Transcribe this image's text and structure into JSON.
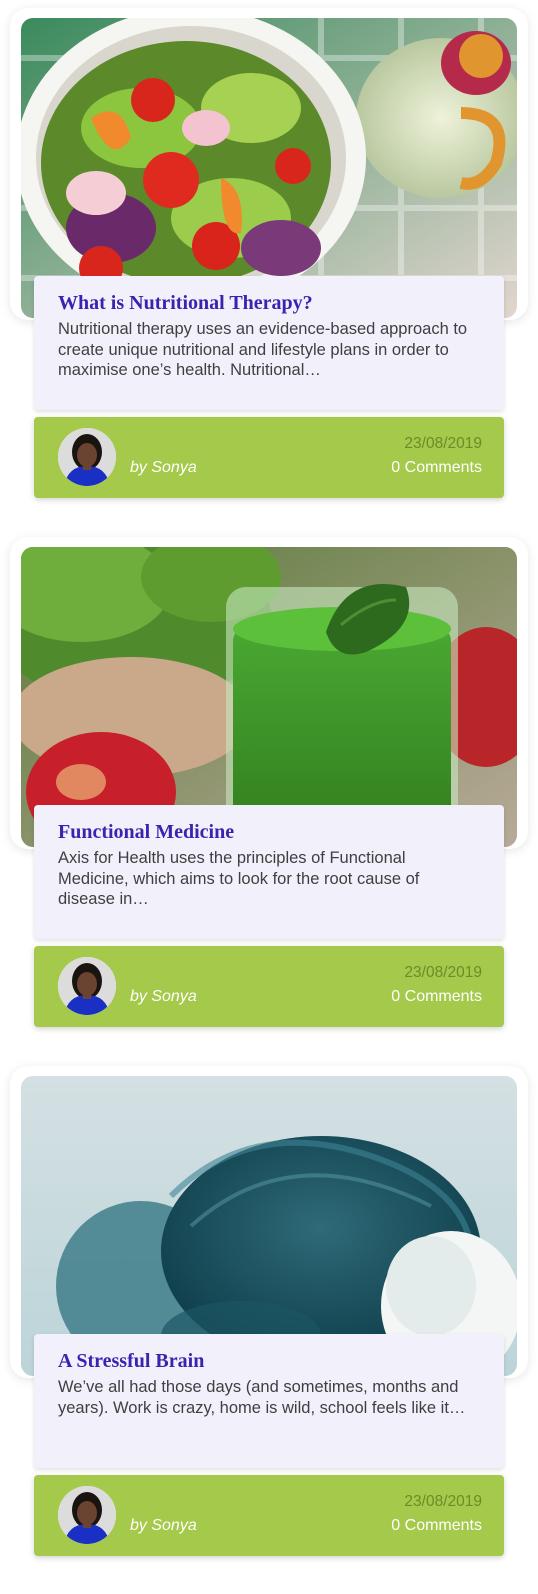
{
  "posts": [
    {
      "title": "What is Nutritional Therapy?",
      "excerpt": "Nutritional therapy uses an evidence-based approach to create unique nutritional and lifestyle plans in order to maximise one’s health. Nutritional…",
      "author": "by Sonya",
      "date": "23/08/2019",
      "comments": "0 Comments",
      "image": "salad-bowl-photo"
    },
    {
      "title": "Functional Medicine",
      "excerpt": "Axis for Health uses the principles of Functional Medicine, which aims to look for the root cause of disease in…",
      "author": "by Sonya",
      "date": "23/08/2019",
      "comments": "0 Comments",
      "image": "green-smoothie-photo"
    },
    {
      "title": "A Stressful Brain",
      "excerpt": "We’ve all had those days (and sometimes, months and years). Work is crazy, home is wild, school feels like it…",
      "author": "by Sonya",
      "date": "23/08/2019",
      "comments": "0 Comments",
      "image": "stressed-woman-photo"
    }
  ],
  "colors": {
    "title": "#3d22b0",
    "card_background": "#f2f0fb",
    "footer_green": "#a5c94a",
    "date_text": "#6f8a2a"
  }
}
